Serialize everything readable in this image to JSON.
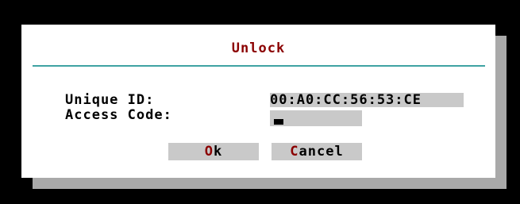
{
  "dialog": {
    "title": "Unlock",
    "unique_id_label": "Unique ID:",
    "unique_id_value": "00:A0:CC:56:53:CE",
    "access_code_label": "Access Code:",
    "access_code_value": ""
  },
  "buttons": {
    "ok": {
      "hotkey": "O",
      "rest": "k"
    },
    "cancel": {
      "hotkey": "C",
      "rest": "ancel"
    }
  },
  "colors": {
    "background": "#000000",
    "dialog": "#ffffff",
    "shadow": "#a9a9a9",
    "field": "#c9c9c9",
    "accent_text": "#8b0000",
    "divider": "#3fa3a3"
  }
}
